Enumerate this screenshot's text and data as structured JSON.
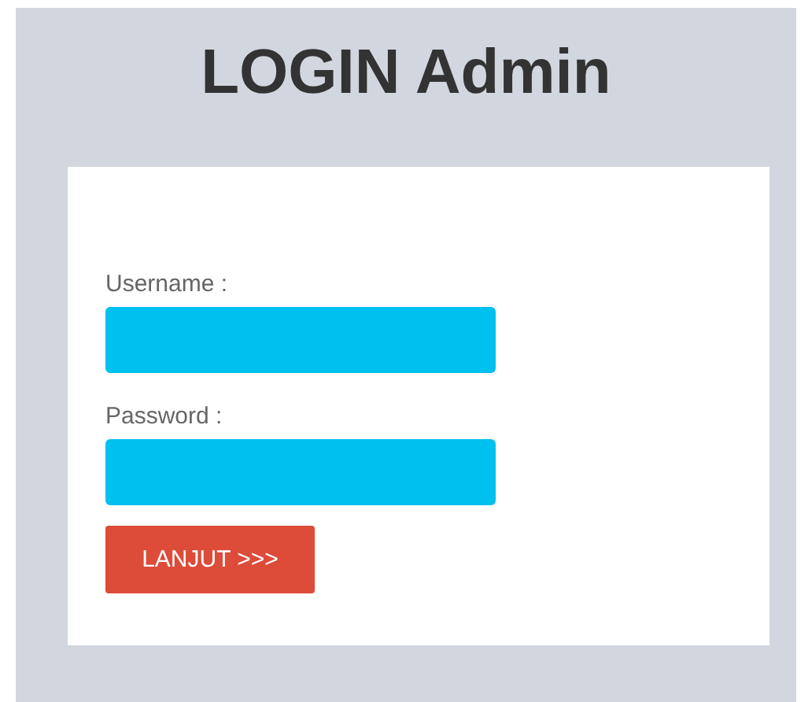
{
  "title": "LOGIN Admin",
  "fields": [
    {
      "label": "Username :"
    },
    {
      "label": "Password :"
    }
  ],
  "submit": {
    "label": "LANJUT >>>"
  }
}
